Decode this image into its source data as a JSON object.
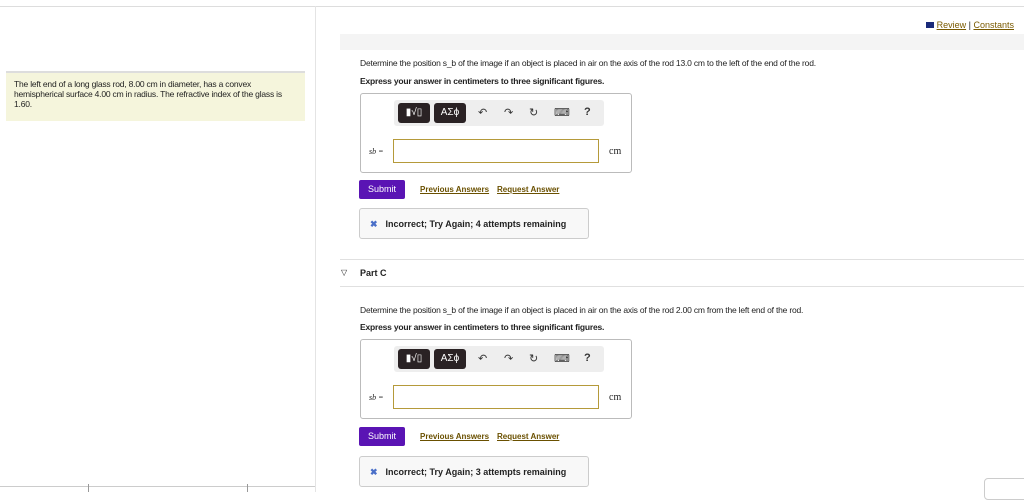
{
  "header": {
    "review": "Review",
    "sep": "|",
    "constants": "Constants"
  },
  "problem": "The left end of a long glass rod, 8.00 cm in diameter, has a convex hemispherical surface 4.00 cm in radius. The refractive index of the glass is 1.60.",
  "partB": {
    "question": "Determine the position s_b of the image if an object is placed in air on the axis of the rod 13.0 cm to the left of the end of the rod.",
    "instruction": "Express your answer in centimeters to three significant figures.",
    "var": "sb =",
    "unit": "cm",
    "value": "",
    "feedback": "Incorrect; Try Again; 4 attempts remaining"
  },
  "partC": {
    "title": "Part C",
    "question": "Determine the position s_b of the image if an object is placed in air on the axis of the rod 2.00 cm from the left end of the rod.",
    "instruction": "Express your answer in centimeters to three significant figures.",
    "var": "sb =",
    "unit": "cm",
    "value": "",
    "feedback": "Incorrect; Try Again; 3 attempts remaining"
  },
  "toolbar": {
    "templates": "▮√▯",
    "greek": "ΑΣϕ",
    "undo": "↶",
    "redo": "↷",
    "reset": "↻",
    "keyboard": "⌨",
    "help": "?"
  },
  "actions": {
    "submit": "Submit",
    "previous": "Previous Answers",
    "request": "Request Answer"
  },
  "colors": {
    "submit": "#5a14b4",
    "link": "#6a5000",
    "panel": "#f5f5dc"
  }
}
